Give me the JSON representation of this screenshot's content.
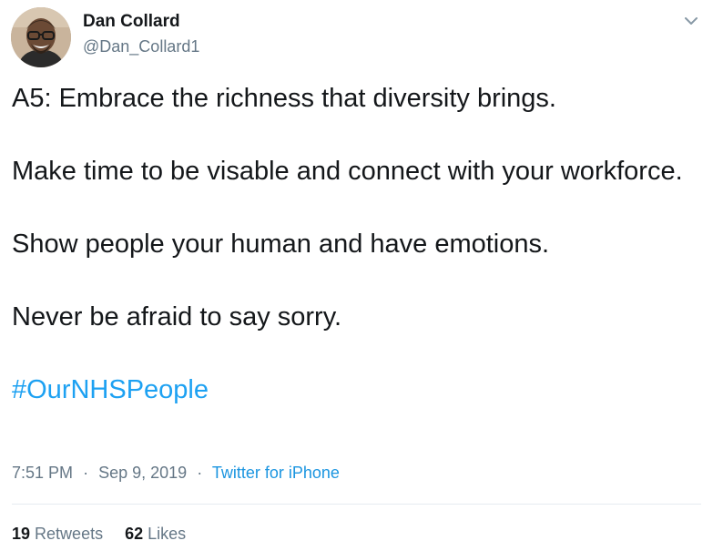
{
  "author": {
    "display_name": "Dan Collard",
    "handle": "@Dan_Collard1"
  },
  "tweet": {
    "paragraphs": [
      "A5: Embrace the richness that diversity brings.",
      "Make time to be visable and connect with your workforce.",
      "Show people your human and have emotions.",
      "Never be afraid to say sorry."
    ],
    "hashtag": "#OurNHSPeople"
  },
  "meta": {
    "time": "7:51 PM",
    "separator": "·",
    "date": "Sep 9, 2019",
    "source": "Twitter for iPhone"
  },
  "stats": {
    "retweets_count": "19",
    "retweets_label": "Retweets",
    "likes_count": "62",
    "likes_label": "Likes"
  },
  "colors": {
    "link": "#1da1f2",
    "secondary_text": "#657786",
    "primary_text": "#14171a",
    "divider": "#e6ecf0"
  },
  "icons": {
    "menu": "chevron-down-icon",
    "avatar": "profile-photo"
  }
}
